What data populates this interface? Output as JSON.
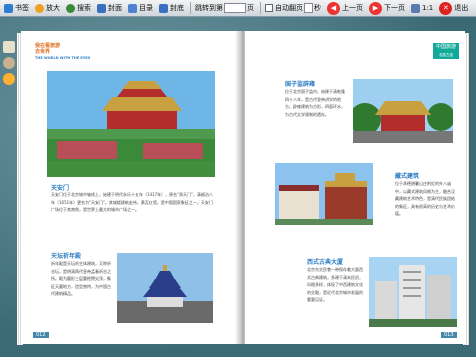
{
  "toolbar": {
    "bookmark": "书签",
    "zoom_in": "放大",
    "search": "搜索",
    "cover": "封面",
    "toc": "目录",
    "back_cover": "封底",
    "jump_to": "跳转到第",
    "page_unit": "页",
    "auto_flip": "自动翻页",
    "seconds": "秒",
    "prev": "上一页",
    "next": "下一页",
    "ratio": "1:1",
    "exit": "退出"
  },
  "left_page": {
    "header_title": "我在看旅游\n去世界",
    "header_sub": "THE WORLD WITH THE EYES",
    "section1_title": "天安门",
    "section1_text": "天安门位于北京城中轴线上，始建于明代永乐十五年（1417年），原名\"承天门\"，清顺治八年（1651年）更名为\"天安门\"。其城楼建筑宏伟，黄瓦红墙，是中国国家象征之一。天安门广场位于其南侧，是世界上最大的城市广场之一。",
    "section2_title": "天坛祈年殿",
    "section2_text": "祈年殿是天坛的主体建筑，又称祈谷坛，是明清两代皇帝孟春祈谷之所。殿为圆形三层重檐攒尖顶，象征天圆地方，造型独特，为中国古代建筑精品。",
    "page_number": "012"
  },
  "right_page": {
    "header_badge": "中国旅游",
    "header_sub": "名胜古迹",
    "section1_title": "国子监辟雍",
    "section1_text": "位于北京国子监内，始建于清乾隆四十八年，是古代皇帝讲学的地方。辟雍建筑为方形，四面环水，为古代太学规制的遗存。",
    "section2_title": "藏式建筑",
    "section2_text": "位于承德避暑山庄附近的外八庙中，以藏式建筑风格为主，融合汉藏建筑艺术特色，是清代民族团结的象征，具有很高的历史与艺术价值。",
    "section3_title": "西式古典大厦",
    "section3_text": "北京东交民巷一带保存着大量西式古典建筑，多建于清末民初，风格多样，体现了中西建筑文化的交融，是近代北京城市发展的重要见证。",
    "page_number": "013"
  }
}
